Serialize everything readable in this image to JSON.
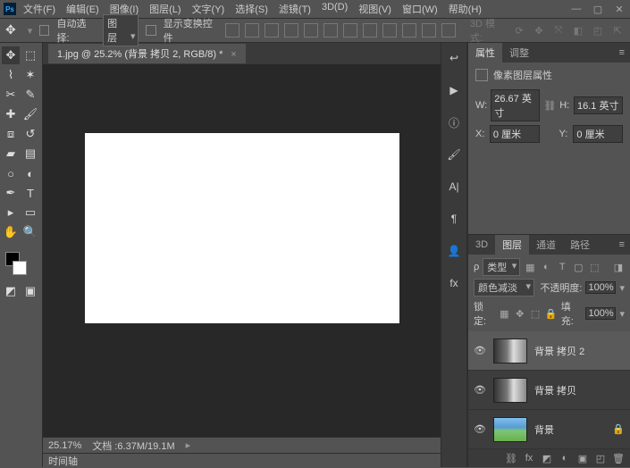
{
  "menu": [
    "文件(F)",
    "编辑(E)",
    "图像(I)",
    "图层(L)",
    "文字(Y)",
    "选择(S)",
    "滤镜(T)",
    "3D(D)",
    "视图(V)",
    "窗口(W)",
    "帮助(H)"
  ],
  "options_bar": {
    "auto_select_label": "自动选择:",
    "auto_select_value": "图层",
    "show_transform_label": "显示变换控件",
    "mode3d_label": "3D 模式:"
  },
  "document": {
    "tab_title": "1.jpg @ 25.2% (背景 拷贝 2, RGB/8) *",
    "zoom": "25.17%",
    "doc_size": "文档 :6.37M/19.1M"
  },
  "timeline_label": "时间轴",
  "panels": {
    "props_tab": "属性",
    "adjust_tab": "调整",
    "props_title": "像素图层属性",
    "w_label": "W:",
    "w_value": "26.67 英寸",
    "h_label": "H:",
    "h_value": "16.1 英寸",
    "x_label": "X:",
    "x_value": "0 厘米",
    "y_label": "Y:",
    "y_value": "0 厘米"
  },
  "layers_panel": {
    "tabs": [
      "3D",
      "图层",
      "通道",
      "路径"
    ],
    "kind_label": "类型",
    "blend_mode": "颜色减淡",
    "opacity_label": "不透明度:",
    "opacity_value": "100%",
    "lock_label": "锁定:",
    "fill_label": "填充:",
    "fill_value": "100%",
    "layers": [
      {
        "name": "背景 拷贝 2",
        "visible": true,
        "selected": true,
        "thumb": "bw"
      },
      {
        "name": "背景 拷贝",
        "visible": true,
        "selected": false,
        "thumb": "bw"
      },
      {
        "name": "背景",
        "visible": true,
        "selected": false,
        "thumb": "color",
        "locked": true
      }
    ]
  }
}
